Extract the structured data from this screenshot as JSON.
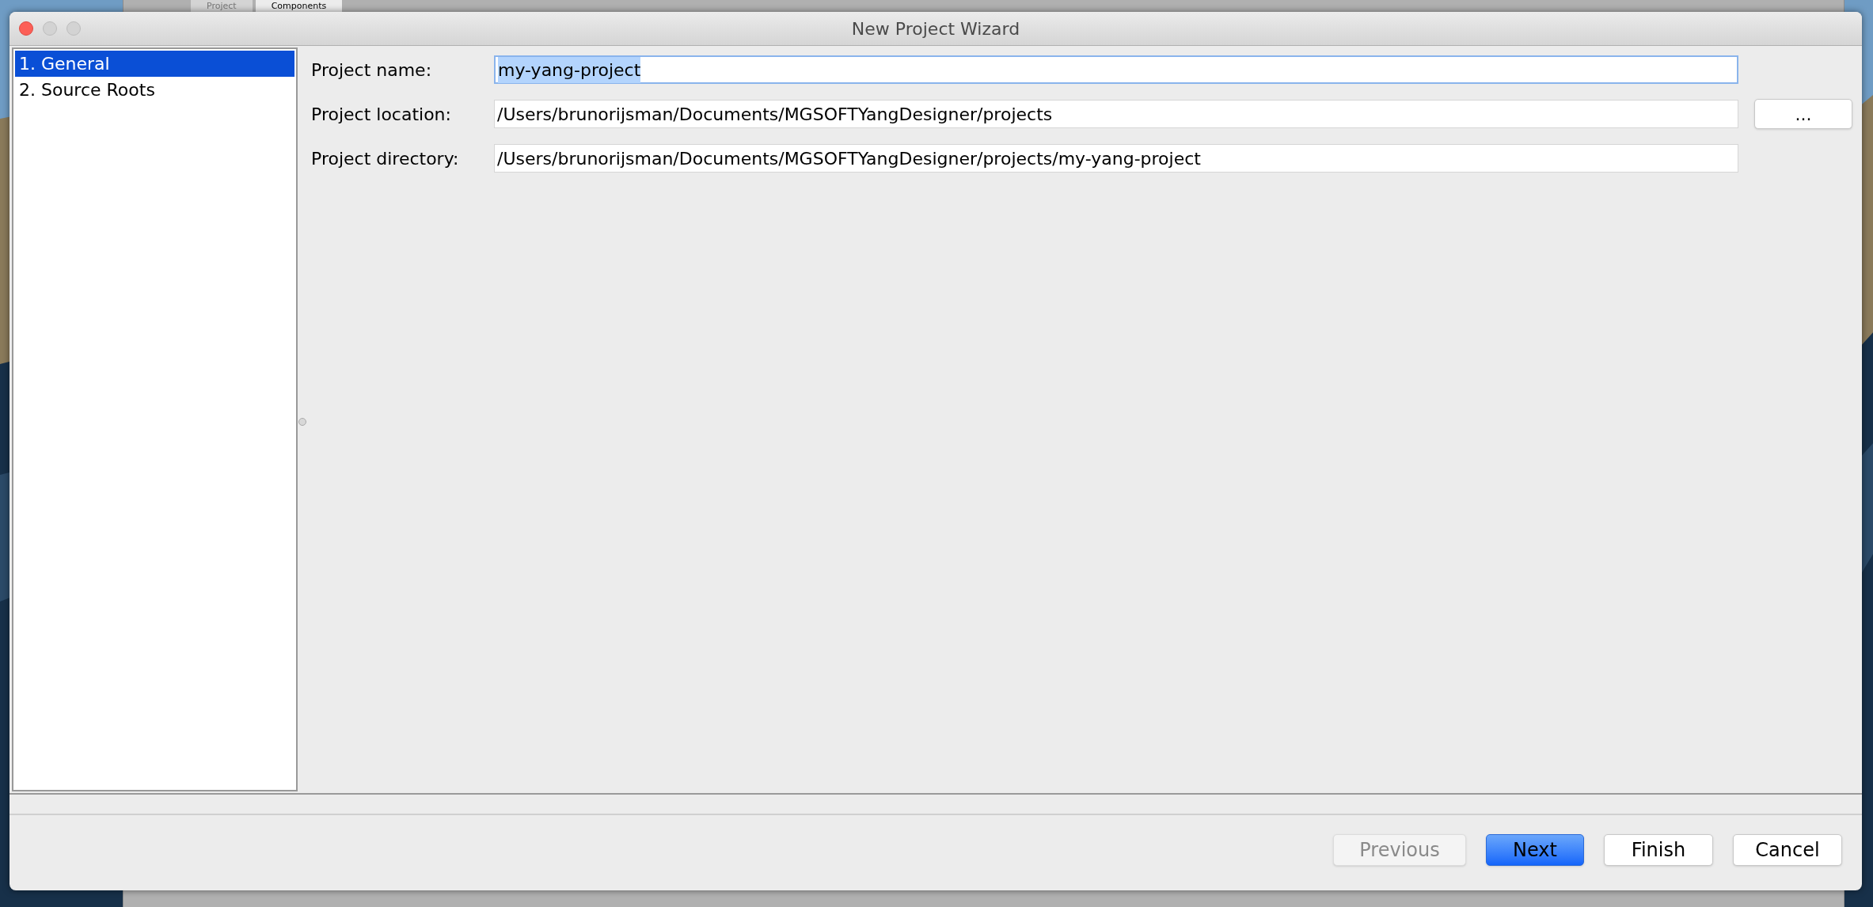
{
  "background_app": {
    "tabs": [
      {
        "label": "Project",
        "selected": false
      },
      {
        "label": "Components",
        "selected": true
      }
    ]
  },
  "window": {
    "title": "New Project Wizard"
  },
  "steps": [
    {
      "label": "1. General",
      "selected": true
    },
    {
      "label": "2. Source Roots",
      "selected": false
    }
  ],
  "fields": [
    {
      "label": "Project name:",
      "value": "my-yang-project",
      "focused": true,
      "browse": false
    },
    {
      "label": "Project location:",
      "value": "/Users/brunorijsman/Documents/MGSOFTYangDesigner/projects",
      "focused": false,
      "browse": true,
      "browse_label": "..."
    },
    {
      "label": "Project directory:",
      "value": "/Users/brunorijsman/Documents/MGSOFTYangDesigner/projects/my-yang-project",
      "focused": false,
      "browse": false
    }
  ],
  "buttons": [
    {
      "label": "Previous",
      "disabled": true,
      "default": false
    },
    {
      "label": "Next",
      "disabled": false,
      "default": true
    },
    {
      "label": "Finish",
      "disabled": false,
      "default": false
    },
    {
      "label": "Cancel",
      "disabled": false,
      "default": false
    }
  ]
}
